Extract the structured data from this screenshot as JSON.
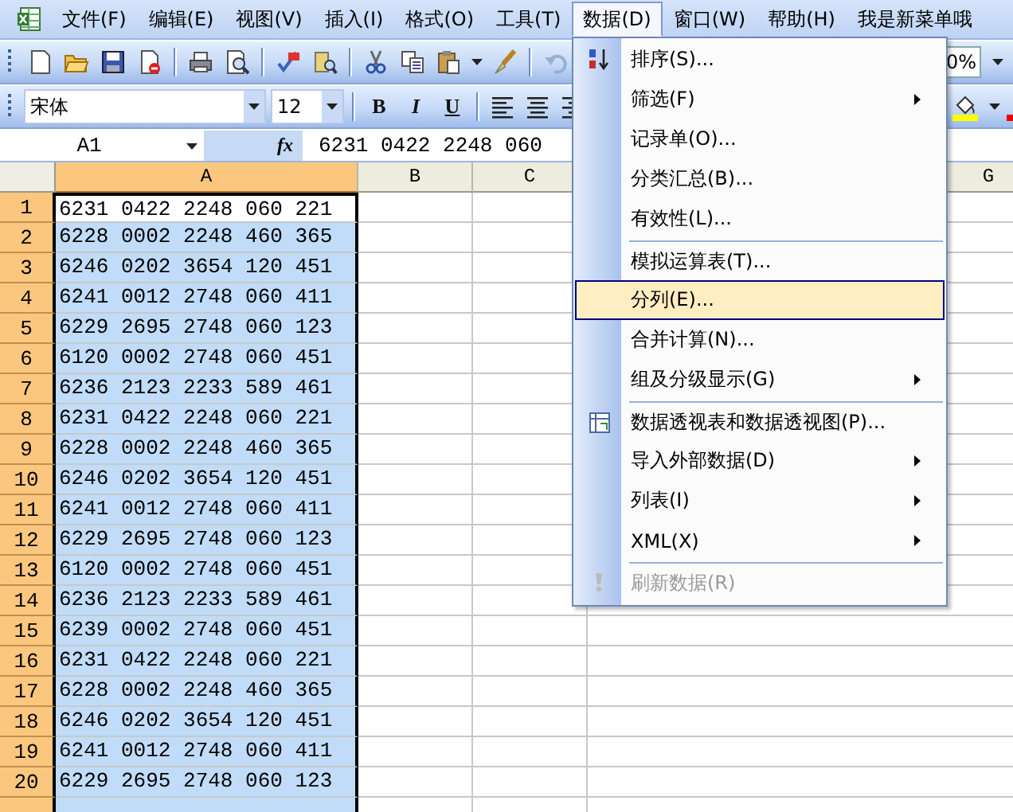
{
  "menubar": [
    {
      "label": "文件(F)",
      "open": false
    },
    {
      "label": "编辑(E)",
      "open": false
    },
    {
      "label": "视图(V)",
      "open": false
    },
    {
      "label": "插入(I)",
      "open": false
    },
    {
      "label": "格式(O)",
      "open": false
    },
    {
      "label": "工具(T)",
      "open": false
    },
    {
      "label": "数据(D)",
      "open": true
    },
    {
      "label": "窗口(W)",
      "open": false
    },
    {
      "label": "帮助(H)",
      "open": false
    },
    {
      "label": "我是新菜单哦",
      "open": false
    }
  ],
  "standard_toolbar": {
    "zoom": "0%"
  },
  "format_toolbar": {
    "font": "宋体",
    "size": "12",
    "bold": "B",
    "italic": "I",
    "underline": "U"
  },
  "formula_bar": {
    "name_box": "A1",
    "function_label": "fx",
    "content": "6231 0422 2248 060"
  },
  "columns": [
    {
      "label": "A",
      "selected": true
    },
    {
      "label": "B",
      "selected": false
    },
    {
      "label": "C",
      "selected": false
    },
    {
      "label": "G",
      "selected": false
    }
  ],
  "rows": [
    {
      "header": "1",
      "selected": true,
      "cell": {
        "text": "6231 0422 2248 060 221",
        "active": true
      }
    },
    {
      "header": "2",
      "selected": true,
      "cell": {
        "text": "6228 0002 2248 460 365",
        "active": false
      }
    },
    {
      "header": "3",
      "selected": true,
      "cell": {
        "text": "6246 0202 3654 120 451",
        "active": false
      }
    },
    {
      "header": "4",
      "selected": true,
      "cell": {
        "text": "6241 0012 2748 060 411",
        "active": false
      }
    },
    {
      "header": "5",
      "selected": true,
      "cell": {
        "text": "6229 2695 2748 060 123",
        "active": false
      }
    },
    {
      "header": "6",
      "selected": true,
      "cell": {
        "text": "6120 0002 2748 060 451",
        "active": false
      }
    },
    {
      "header": "7",
      "selected": true,
      "cell": {
        "text": "6236 2123 2233 589 461",
        "active": false
      }
    },
    {
      "header": "8",
      "selected": true,
      "cell": {
        "text": "6231 0422 2248 060 221",
        "active": false
      }
    },
    {
      "header": "9",
      "selected": true,
      "cell": {
        "text": "6228 0002 2248 460 365",
        "active": false
      }
    },
    {
      "header": "10",
      "selected": true,
      "cell": {
        "text": "6246 0202 3654 120 451",
        "active": false
      }
    },
    {
      "header": "11",
      "selected": true,
      "cell": {
        "text": "6241 0012 2748 060 411",
        "active": false
      }
    },
    {
      "header": "12",
      "selected": true,
      "cell": {
        "text": "6229 2695 2748 060 123",
        "active": false
      }
    },
    {
      "header": "13",
      "selected": true,
      "cell": {
        "text": "6120 0002 2748 060 451",
        "active": false
      }
    },
    {
      "header": "14",
      "selected": true,
      "cell": {
        "text": "6236 2123 2233 589 461",
        "active": false
      }
    },
    {
      "header": "15",
      "selected": true,
      "cell": {
        "text": "6239 0002 2748 060 451",
        "active": false
      }
    },
    {
      "header": "16",
      "selected": true,
      "cell": {
        "text": "6231 0422 2248 060 221",
        "active": false
      }
    },
    {
      "header": "17",
      "selected": true,
      "cell": {
        "text": "6228 0002 2248 460 365",
        "active": false
      }
    },
    {
      "header": "18",
      "selected": true,
      "cell": {
        "text": "6246 0202 3654 120 451",
        "active": false
      }
    },
    {
      "header": "19",
      "selected": true,
      "cell": {
        "text": "6241 0012 2748 060 411",
        "active": false
      }
    },
    {
      "header": "20",
      "selected": true,
      "cell": {
        "text": "6229 2695 2748 060 123",
        "active": false
      }
    }
  ],
  "data_menu": {
    "items": [
      {
        "label": "排序(S)...",
        "submenu": false,
        "selected": false,
        "disabled": false,
        "separator_before": false
      },
      {
        "label": "筛选(F)",
        "submenu": true,
        "selected": false,
        "disabled": false,
        "separator_before": false
      },
      {
        "label": "记录单(O)...",
        "submenu": false,
        "selected": false,
        "disabled": false,
        "separator_before": false
      },
      {
        "label": "分类汇总(B)...",
        "submenu": false,
        "selected": false,
        "disabled": false,
        "separator_before": false
      },
      {
        "label": "有效性(L)...",
        "submenu": false,
        "selected": false,
        "disabled": false,
        "separator_before": false
      },
      {
        "label": "模拟运算表(T)...",
        "submenu": false,
        "selected": false,
        "disabled": false,
        "separator_before": true
      },
      {
        "label": "分列(E)...",
        "submenu": false,
        "selected": true,
        "disabled": false,
        "separator_before": false
      },
      {
        "label": "合并计算(N)...",
        "submenu": false,
        "selected": false,
        "disabled": false,
        "separator_before": false
      },
      {
        "label": "组及分级显示(G)",
        "submenu": true,
        "selected": false,
        "disabled": false,
        "separator_before": false
      },
      {
        "label": "数据透视表和数据透视图(P)...",
        "submenu": false,
        "selected": false,
        "disabled": false,
        "separator_before": true
      },
      {
        "label": "导入外部数据(D)",
        "submenu": true,
        "selected": false,
        "disabled": false,
        "separator_before": false
      },
      {
        "label": "列表(I)",
        "submenu": true,
        "selected": false,
        "disabled": false,
        "separator_before": false
      },
      {
        "label": "XML(X)",
        "submenu": true,
        "selected": false,
        "disabled": false,
        "separator_before": false
      },
      {
        "label": "刷新数据(R)",
        "submenu": false,
        "selected": false,
        "disabled": true,
        "separator_before": true
      }
    ]
  }
}
